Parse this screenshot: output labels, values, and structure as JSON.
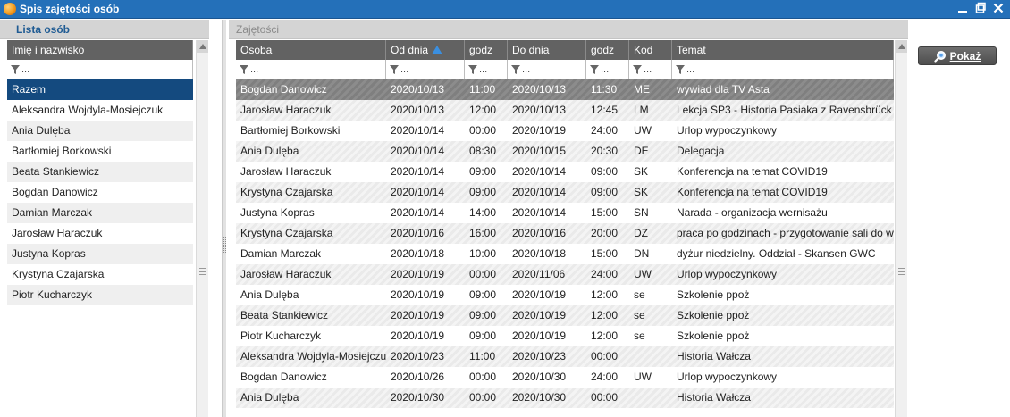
{
  "window": {
    "title": "Spis zajętości osób",
    "controls": [
      "minimize-icon",
      "restore-icon",
      "close-icon"
    ]
  },
  "left": {
    "title": "Lista osób",
    "column": "Imię i nazwisko",
    "filter_text": "...",
    "items": [
      "Razem",
      "Aleksandra Wojdyla-Mosiejczuk",
      "Ania Dulęba",
      "Bartłomiej Borkowski",
      "Beata Stankiewicz",
      "Bogdan Danowicz",
      "Damian Marczak",
      "Jarosław Haraczuk",
      "Justyna Kopras",
      "Krystyna Czajarska",
      "Piotr Kucharczyk"
    ],
    "selected_index": 0
  },
  "main": {
    "title": "Zajętości",
    "columns": [
      "Osoba",
      "Od dnia",
      "godz",
      "Do dnia",
      "godz",
      "Kod",
      "Temat"
    ],
    "sort_column": "Od dnia",
    "sort_direction": "ascending",
    "filter_text": "...",
    "rows": [
      [
        "Bogdan Danowicz",
        "2020/10/13",
        "11:00",
        "2020/10/13",
        "11:30",
        "ME",
        "wywiad dla TV Asta"
      ],
      [
        "Jarosław Haraczuk",
        "2020/10/13",
        "12:00",
        "2020/10/13",
        "12:45",
        "LM",
        "Lekcja SP3 - Historia Pasiaka z Ravensbrück"
      ],
      [
        "Bartłomiej Borkowski",
        "2020/10/14",
        "00:00",
        "2020/10/19",
        "24:00",
        "UW",
        "Urlop wypoczynkowy"
      ],
      [
        "Ania Dulęba",
        "2020/10/14",
        "08:30",
        "2020/10/15",
        "20:30",
        "DE",
        "Delegacja"
      ],
      [
        "Jarosław Haraczuk",
        "2020/10/14",
        "09:00",
        "2020/10/14",
        "09:00",
        "SK",
        "Konferencja na temat COVID19"
      ],
      [
        "Krystyna Czajarska",
        "2020/10/14",
        "09:00",
        "2020/10/14",
        "09:00",
        "SK",
        "Konferencja na temat COVID19"
      ],
      [
        "Justyna Kopras",
        "2020/10/14",
        "14:00",
        "2020/10/14",
        "15:00",
        "SN",
        "Narada - organizacja wernisażu"
      ],
      [
        "Krystyna Czajarska",
        "2020/10/16",
        "16:00",
        "2020/10/16",
        "20:00",
        "DZ",
        "praca po godzinach - przygotowanie sali do w"
      ],
      [
        "Damian Marczak",
        "2020/10/18",
        "10:00",
        "2020/10/18",
        "15:00",
        "DN",
        "dyżur niedzielny. Oddział - Skansen GWC"
      ],
      [
        "Jarosław Haraczuk",
        "2020/10/19",
        "00:00",
        "2020/11/06",
        "24:00",
        "UW",
        "Urlop wypoczynkowy"
      ],
      [
        "Ania Dulęba",
        "2020/10/19",
        "09:00",
        "2020/10/19",
        "12:00",
        "se",
        "Szkolenie ppoż"
      ],
      [
        "Beata Stankiewicz",
        "2020/10/19",
        "09:00",
        "2020/10/19",
        "12:00",
        "se",
        "Szkolenie ppoż"
      ],
      [
        "Piotr Kucharczyk",
        "2020/10/19",
        "09:00",
        "2020/10/19",
        "12:00",
        "se",
        "Szkolenie ppoż"
      ],
      [
        "Aleksandra Wojdyla-Mosiejczuk",
        "2020/10/23",
        "11:00",
        "2020/10/23",
        "00:00",
        "",
        "Historia Wałcza"
      ],
      [
        "Bogdan Danowicz",
        "2020/10/26",
        "00:00",
        "2020/10/30",
        "24:00",
        "UW",
        "Urlop wypoczynkowy"
      ],
      [
        "Ania Dulęba",
        "2020/10/30",
        "00:00",
        "2020/10/30",
        "00:00",
        "",
        "Historia Wałcza"
      ]
    ],
    "selected_index": 0
  },
  "show_button": {
    "label": "Pokaż",
    "icon": "magnifier-icon"
  },
  "colors": {
    "titlebar": "#2470b9",
    "left_selection": "#144a7f",
    "header": "#626262",
    "sort_arrow": "#3a8fe0"
  }
}
